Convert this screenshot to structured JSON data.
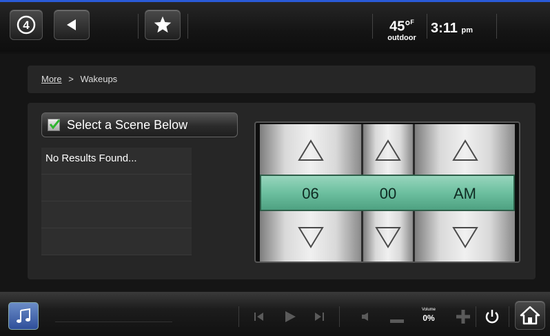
{
  "topbar": {
    "logo_glyph": "4",
    "temperature": "45",
    "temp_unit": "F",
    "weather_label": "outdoor",
    "time": "3:11",
    "ampm": "pm"
  },
  "breadcrumb": {
    "link": "More",
    "separator": ">",
    "current": "Wakeups"
  },
  "scene_header": {
    "label": "Select a Scene Below"
  },
  "scene_list": {
    "items": [
      "No Results Found...",
      "",
      "",
      ""
    ]
  },
  "time_picker": {
    "hour": "06",
    "minute": "00",
    "period": "AM"
  },
  "bottombar": {
    "volume_label": "Volume",
    "volume_value": "0%"
  },
  "colors": {
    "accent_line": "#2a5bd8",
    "picker_band": "#6cbf9f"
  }
}
